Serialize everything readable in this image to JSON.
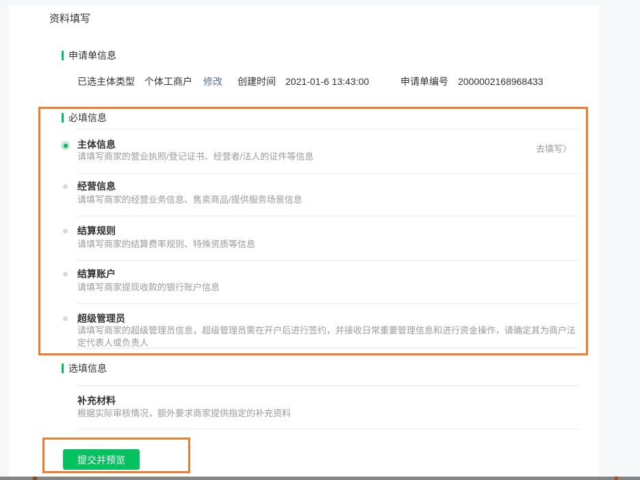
{
  "page": {
    "title": "资料填写"
  },
  "application": {
    "section_title": "申请单信息",
    "subject_type_label": "已选主体类型",
    "subject_type_value": "个体工商户",
    "modify_link": "修改",
    "created_label": "创建时间",
    "created_value": "2021-01-6 13:43:00",
    "app_no_label": "申请单编号",
    "app_no_value": "2000002168968433"
  },
  "required": {
    "section_title": "必填信息",
    "go_fill_label": "去填写",
    "chevron": "〉",
    "items": [
      {
        "title": "主体信息",
        "desc": "请填写商家的营业执照/登记证书、经营者/法人的证件等信息",
        "state": "selected"
      },
      {
        "title": "经营信息",
        "desc": "请填写商家的经营业务信息、售卖商品/提供服务场景信息",
        "state": "pending"
      },
      {
        "title": "结算规则",
        "desc": "请填写商家的结算费率规则、特殊资质等信息",
        "state": "pending"
      },
      {
        "title": "结算账户",
        "desc": "请填写商家提现收款的银行账户信息",
        "state": "pending"
      },
      {
        "title": "超级管理员",
        "desc": "请填写商家的超级管理员信息，超级管理员需在开户后进行签约，并接收日常重要管理信息和进行资金操作，请确定其为商户法定代表人或负责人",
        "state": "pending"
      }
    ]
  },
  "optional": {
    "section_title": "选填信息",
    "items": [
      {
        "title": "补充材料",
        "desc": "根据实际审核情况，额外要求商家提供指定的补充资料"
      }
    ]
  },
  "footer": {
    "submit_label": "提交并预览"
  },
  "colors": {
    "accent_green": "#07c160",
    "highlight_orange": "#ed7d31",
    "link_blue": "#576b95",
    "divider_gray": "#e9e9e9"
  }
}
